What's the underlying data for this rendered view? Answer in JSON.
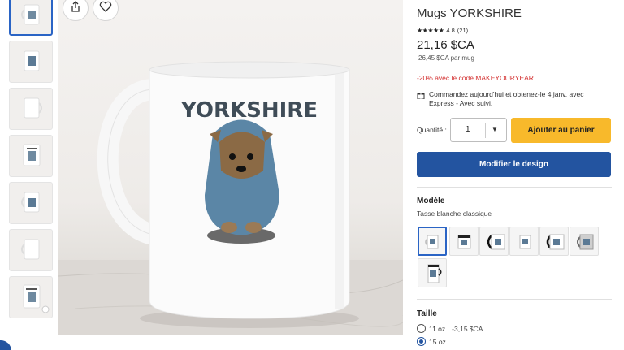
{
  "product": {
    "title": "Mugs YORKSHIRE",
    "rating_value": "4.8",
    "rating_count": "(21)",
    "stars": "★★★★★",
    "price": "21,16 $CA",
    "old_price": "26,45 $CA",
    "old_price_suffix": "par mug",
    "promo": "-20% avec le code MAKEYOURYEAR",
    "shipping": "Commandez aujourd'hui et obtenez-le 4 janv. avec Express - Avec suivi.",
    "mug_print_text": "YORKSHIRE"
  },
  "quantity": {
    "label": "Quantité :",
    "value": "1"
  },
  "buttons": {
    "add_to_cart": "Ajouter au panier",
    "edit_design": "Modifier le design"
  },
  "model": {
    "title": "Modèle",
    "selected": "Tasse blanche classique",
    "option_count": 7
  },
  "size": {
    "title": "Taille",
    "options": [
      {
        "label": "11 oz",
        "delta": "-3,15 $CA",
        "selected": false
      },
      {
        "label": "15 oz",
        "delta": "",
        "selected": true
      }
    ]
  },
  "colors": {
    "accent_blue": "#2354a0",
    "cart_yellow": "#f8b92b",
    "promo_red": "#d32f2f",
    "selected_border": "#2a64c5"
  },
  "icons": {
    "share": "share-icon",
    "favorite": "heart-icon",
    "shipping": "gift-icon",
    "qty_dropdown": "caret-down-icon"
  }
}
